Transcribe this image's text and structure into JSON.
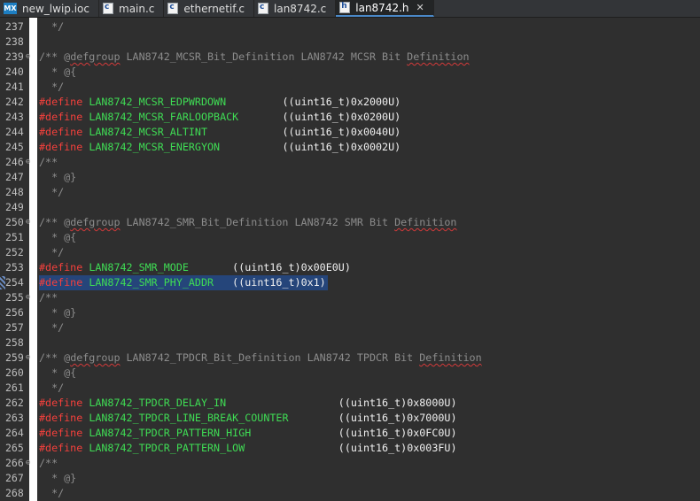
{
  "tabs": [
    {
      "label": "new_lwip.ioc",
      "icon": "mx-icon",
      "active": false
    },
    {
      "label": "main.c",
      "icon": "c-file-icon",
      "active": false
    },
    {
      "label": "ethernetif.c",
      "icon": "c-file-icon",
      "active": false
    },
    {
      "label": "lan8742.c",
      "icon": "c-file-icon",
      "active": false
    },
    {
      "label": "lan8742.h",
      "icon": "h-file-icon",
      "active": true
    }
  ],
  "mx_badge": "MX",
  "close_glyph": "✕",
  "fold_glyph": "⊖",
  "lines": [
    {
      "num": "237",
      "text": "  */"
    },
    {
      "num": "238",
      "text": ""
    },
    {
      "num": "239",
      "text": "/** @defgroup LAN8742_MCSR_Bit_Definition LAN8742 MCSR Bit Definition",
      "fold": true
    },
    {
      "num": "240",
      "text": "  * @{"
    },
    {
      "num": "241",
      "text": "  */"
    },
    {
      "num": "242",
      "define": "LAN8742_MCSR_EDPWRDOWN",
      "pad": "         ",
      "value": "((uint16_t)0x2000U)"
    },
    {
      "num": "243",
      "define": "LAN8742_MCSR_FARLOOPBACK",
      "pad": "       ",
      "value": "((uint16_t)0x0200U)"
    },
    {
      "num": "244",
      "define": "LAN8742_MCSR_ALTINT",
      "pad": "            ",
      "value": "((uint16_t)0x0040U)"
    },
    {
      "num": "245",
      "define": "LAN8742_MCSR_ENERGYON",
      "pad": "          ",
      "value": "((uint16_t)0x0002U)"
    },
    {
      "num": "246",
      "text": "/**",
      "fold": true
    },
    {
      "num": "247",
      "text": "  * @}"
    },
    {
      "num": "248",
      "text": "  */"
    },
    {
      "num": "249",
      "text": ""
    },
    {
      "num": "250",
      "text": "/** @defgroup LAN8742_SMR_Bit_Definition LAN8742 SMR Bit Definition",
      "fold": true
    },
    {
      "num": "251",
      "text": "  * @{"
    },
    {
      "num": "252",
      "text": "  */"
    },
    {
      "num": "253",
      "define": "LAN8742_SMR_MODE",
      "pad": "       ",
      "value": "((uint16_t)0x00E0U)"
    },
    {
      "num": "254",
      "define": "LAN8742_SMR_PHY_ADDR",
      "pad": "   ",
      "value": "((uint16_t)0x1)",
      "highlight": true
    },
    {
      "num": "255",
      "text": "/**",
      "fold": true
    },
    {
      "num": "256",
      "text": "  * @}"
    },
    {
      "num": "257",
      "text": "  */"
    },
    {
      "num": "258",
      "text": ""
    },
    {
      "num": "259",
      "text": "/** @defgroup LAN8742_TPDCR_Bit_Definition LAN8742 TPDCR Bit Definition",
      "fold": true
    },
    {
      "num": "260",
      "text": "  * @{"
    },
    {
      "num": "261",
      "text": "  */"
    },
    {
      "num": "262",
      "define": "LAN8742_TPDCR_DELAY_IN",
      "pad": "                  ",
      "value": "((uint16_t)0x8000U)"
    },
    {
      "num": "263",
      "define": "LAN8742_TPDCR_LINE_BREAK_COUNTER",
      "pad": "        ",
      "value": "((uint16_t)0x7000U)"
    },
    {
      "num": "264",
      "define": "LAN8742_TPDCR_PATTERN_HIGH",
      "pad": "              ",
      "value": "((uint16_t)0x0FC0U)"
    },
    {
      "num": "265",
      "define": "LAN8742_TPDCR_PATTERN_LOW",
      "pad": "               ",
      "value": "((uint16_t)0x003FU)"
    },
    {
      "num": "266",
      "text": "/**",
      "fold": true
    },
    {
      "num": "267",
      "text": "  * @}"
    },
    {
      "num": "268",
      "text": "  */"
    }
  ],
  "define_keyword": "#define"
}
